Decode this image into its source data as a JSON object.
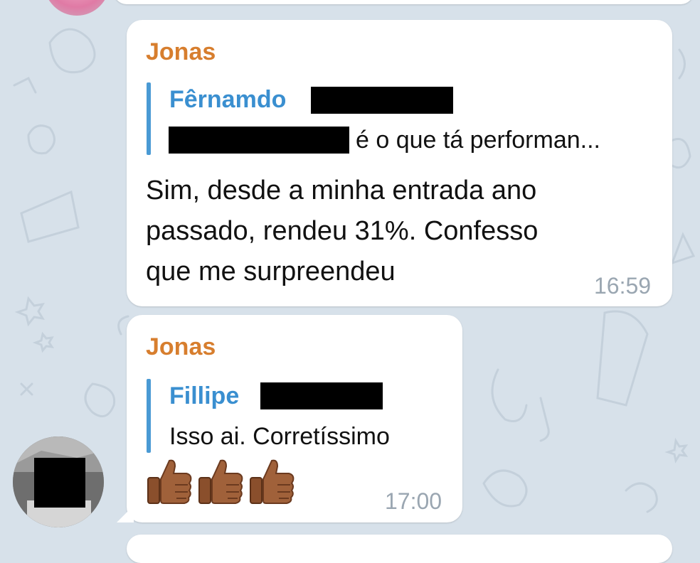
{
  "chat": {
    "messages": [
      {
        "sender": "Jonas",
        "reply": {
          "name": "Fêrnamdo",
          "text": "é o que tá performan..."
        },
        "text_lines": [
          "Sim, desde a minha entrada ano",
          "passado, rendeu 31%. Confesso",
          "que me surpreendeu"
        ],
        "time": "16:59"
      },
      {
        "sender": "Jonas",
        "reply": {
          "name": "Fillipe",
          "text": "Isso ai. Corretíssimo"
        },
        "emoji": "thumbs-up x3",
        "time": "17:00"
      }
    ]
  },
  "colors": {
    "background": "#d7e1ea",
    "bubble": "#ffffff",
    "sender": "#d77e2e",
    "reply_accent": "#4a9ad4",
    "timestamp": "#9aa6b1"
  },
  "icons": [
    "thumbs-up-icon",
    "avatar-image"
  ]
}
